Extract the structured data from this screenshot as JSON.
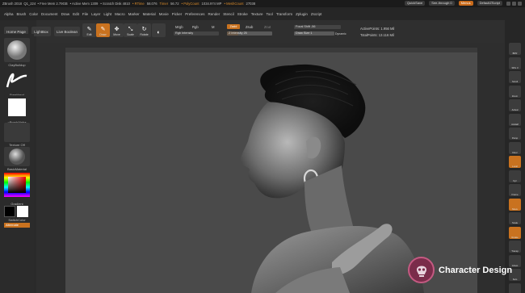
{
  "titlebar": {
    "app": "ZBrush 2018",
    "coords": "Q1_224",
    "stats": [
      {
        "label": "• Free Mem 2.79GB",
        "orange": false
      },
      {
        "label": "• Active Mem 1309",
        "orange": false
      },
      {
        "label": "• Scratch Disk 4810",
        "orange": false
      },
      {
        "label": "• RTime",
        "orange": true
      },
      {
        "label": "58.076",
        "orange": false
      },
      {
        "label": "Timer",
        "orange": true
      },
      {
        "label": "56.72",
        "orange": false
      },
      {
        "label": "• PolyCount",
        "orange": true
      },
      {
        "label": "1034.974 MP",
        "orange": false
      },
      {
        "label": "• MeshCount",
        "orange": true
      },
      {
        "label": "27038",
        "orange": false
      }
    ],
    "quicksave": "QuickSave",
    "see_through": "See-through 0",
    "menus": "Menus",
    "script": "DefaultZScript"
  },
  "menubar": [
    "Alpha",
    "Brush",
    "Color",
    "Document",
    "Draw",
    "Edit",
    "File",
    "Layer",
    "Light",
    "Macro",
    "Marker",
    "Material",
    "Movie",
    "Picker",
    "Preferences",
    "Render",
    "Stencil",
    "Stroke",
    "Texture",
    "Tool",
    "Transform",
    "Zplugin",
    "Zscript"
  ],
  "leftbuttons": {
    "home": "Home Page",
    "lightbox": "LightBox",
    "liveboolean": "Live Boolean"
  },
  "tools": [
    {
      "label": "Edit",
      "glyph": "✎",
      "active": false
    },
    {
      "label": "Draw",
      "glyph": "✎",
      "active": true
    },
    {
      "label": "Move",
      "glyph": "✥",
      "active": false
    },
    {
      "label": "Scale",
      "glyph": "⤡",
      "active": false
    },
    {
      "label": "Rotate",
      "glyph": "↻",
      "active": false
    }
  ],
  "toolbar": {
    "mrgb": "Mrgb",
    "rgb": "Rgb",
    "m": "M",
    "rgb_intensity": "Rgb Intensity",
    "zadd": "Zadd",
    "zsub": "Zsub",
    "zcut": "Zcut",
    "z_intensity": "Z Intensity 25",
    "focal_shift": "Focal Shift -56",
    "draw_size": "Draw Size 1",
    "dynamic": "Dynamic",
    "active_points": "ActivePoints: 1.956 Mil",
    "total_points": "TotalPoints: 13.116 Mil"
  },
  "palette": [
    {
      "label": "ClayBuildup"
    },
    {
      "label": "FreeHand"
    },
    {
      "label": "~BrushAlpha"
    },
    {
      "label": "Texture Off"
    },
    {
      "label": "BasicMaterial"
    },
    {
      "label": "Gradient"
    },
    {
      "label": "SwitchColor"
    },
    {
      "label": "Alternate"
    }
  ],
  "rightshelf": [
    "BPR",
    "SPix 3",
    "Scroll",
    "Zoom",
    "Actual",
    "AAHalf",
    "Persp",
    "Floor",
    "Local",
    "Xyz",
    "Frame",
    "Move",
    "Scale",
    "Rotate",
    "Transp",
    "Ghost",
    "Solo",
    "Xpose"
  ],
  "badge": {
    "text": "Character Design"
  },
  "colors": {
    "accent": "#c9721f",
    "bg": "#2a2a2a",
    "canvas": "#4a4a4a"
  }
}
